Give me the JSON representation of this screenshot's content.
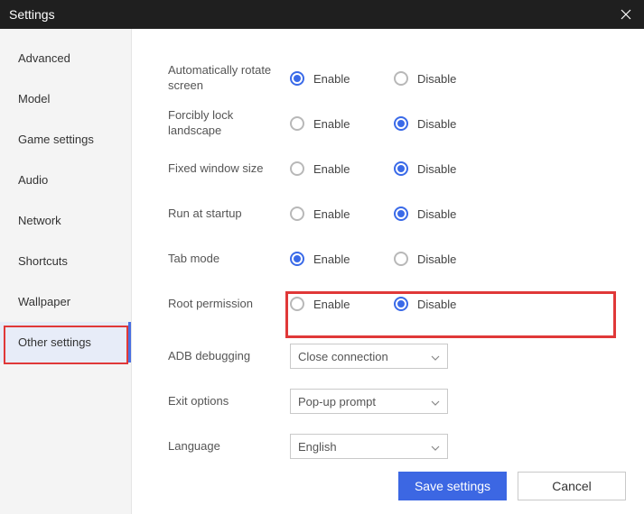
{
  "window": {
    "title": "Settings"
  },
  "sidebar": {
    "items": [
      {
        "label": "Advanced"
      },
      {
        "label": "Model"
      },
      {
        "label": "Game settings"
      },
      {
        "label": "Audio"
      },
      {
        "label": "Network"
      },
      {
        "label": "Shortcuts"
      },
      {
        "label": "Wallpaper"
      },
      {
        "label": "Other settings"
      }
    ],
    "selected_index": 7
  },
  "options": {
    "enable_label": "Enable",
    "disable_label": "Disable",
    "rows": [
      {
        "label": "Automatically rotate screen",
        "value": "enable"
      },
      {
        "label": "Forcibly lock landscape",
        "value": "disable"
      },
      {
        "label": "Fixed window size",
        "value": "disable"
      },
      {
        "label": "Run at startup",
        "value": "disable"
      },
      {
        "label": "Tab mode",
        "value": "enable"
      },
      {
        "label": "Root permission",
        "value": "disable"
      }
    ],
    "highlighted_row_index": 5
  },
  "selects": {
    "adb": {
      "label": "ADB debugging",
      "value": "Close connection"
    },
    "exit": {
      "label": "Exit options",
      "value": "Pop-up prompt"
    },
    "language": {
      "label": "Language",
      "value": "English"
    }
  },
  "buttons": {
    "save": "Save settings",
    "cancel": "Cancel"
  }
}
